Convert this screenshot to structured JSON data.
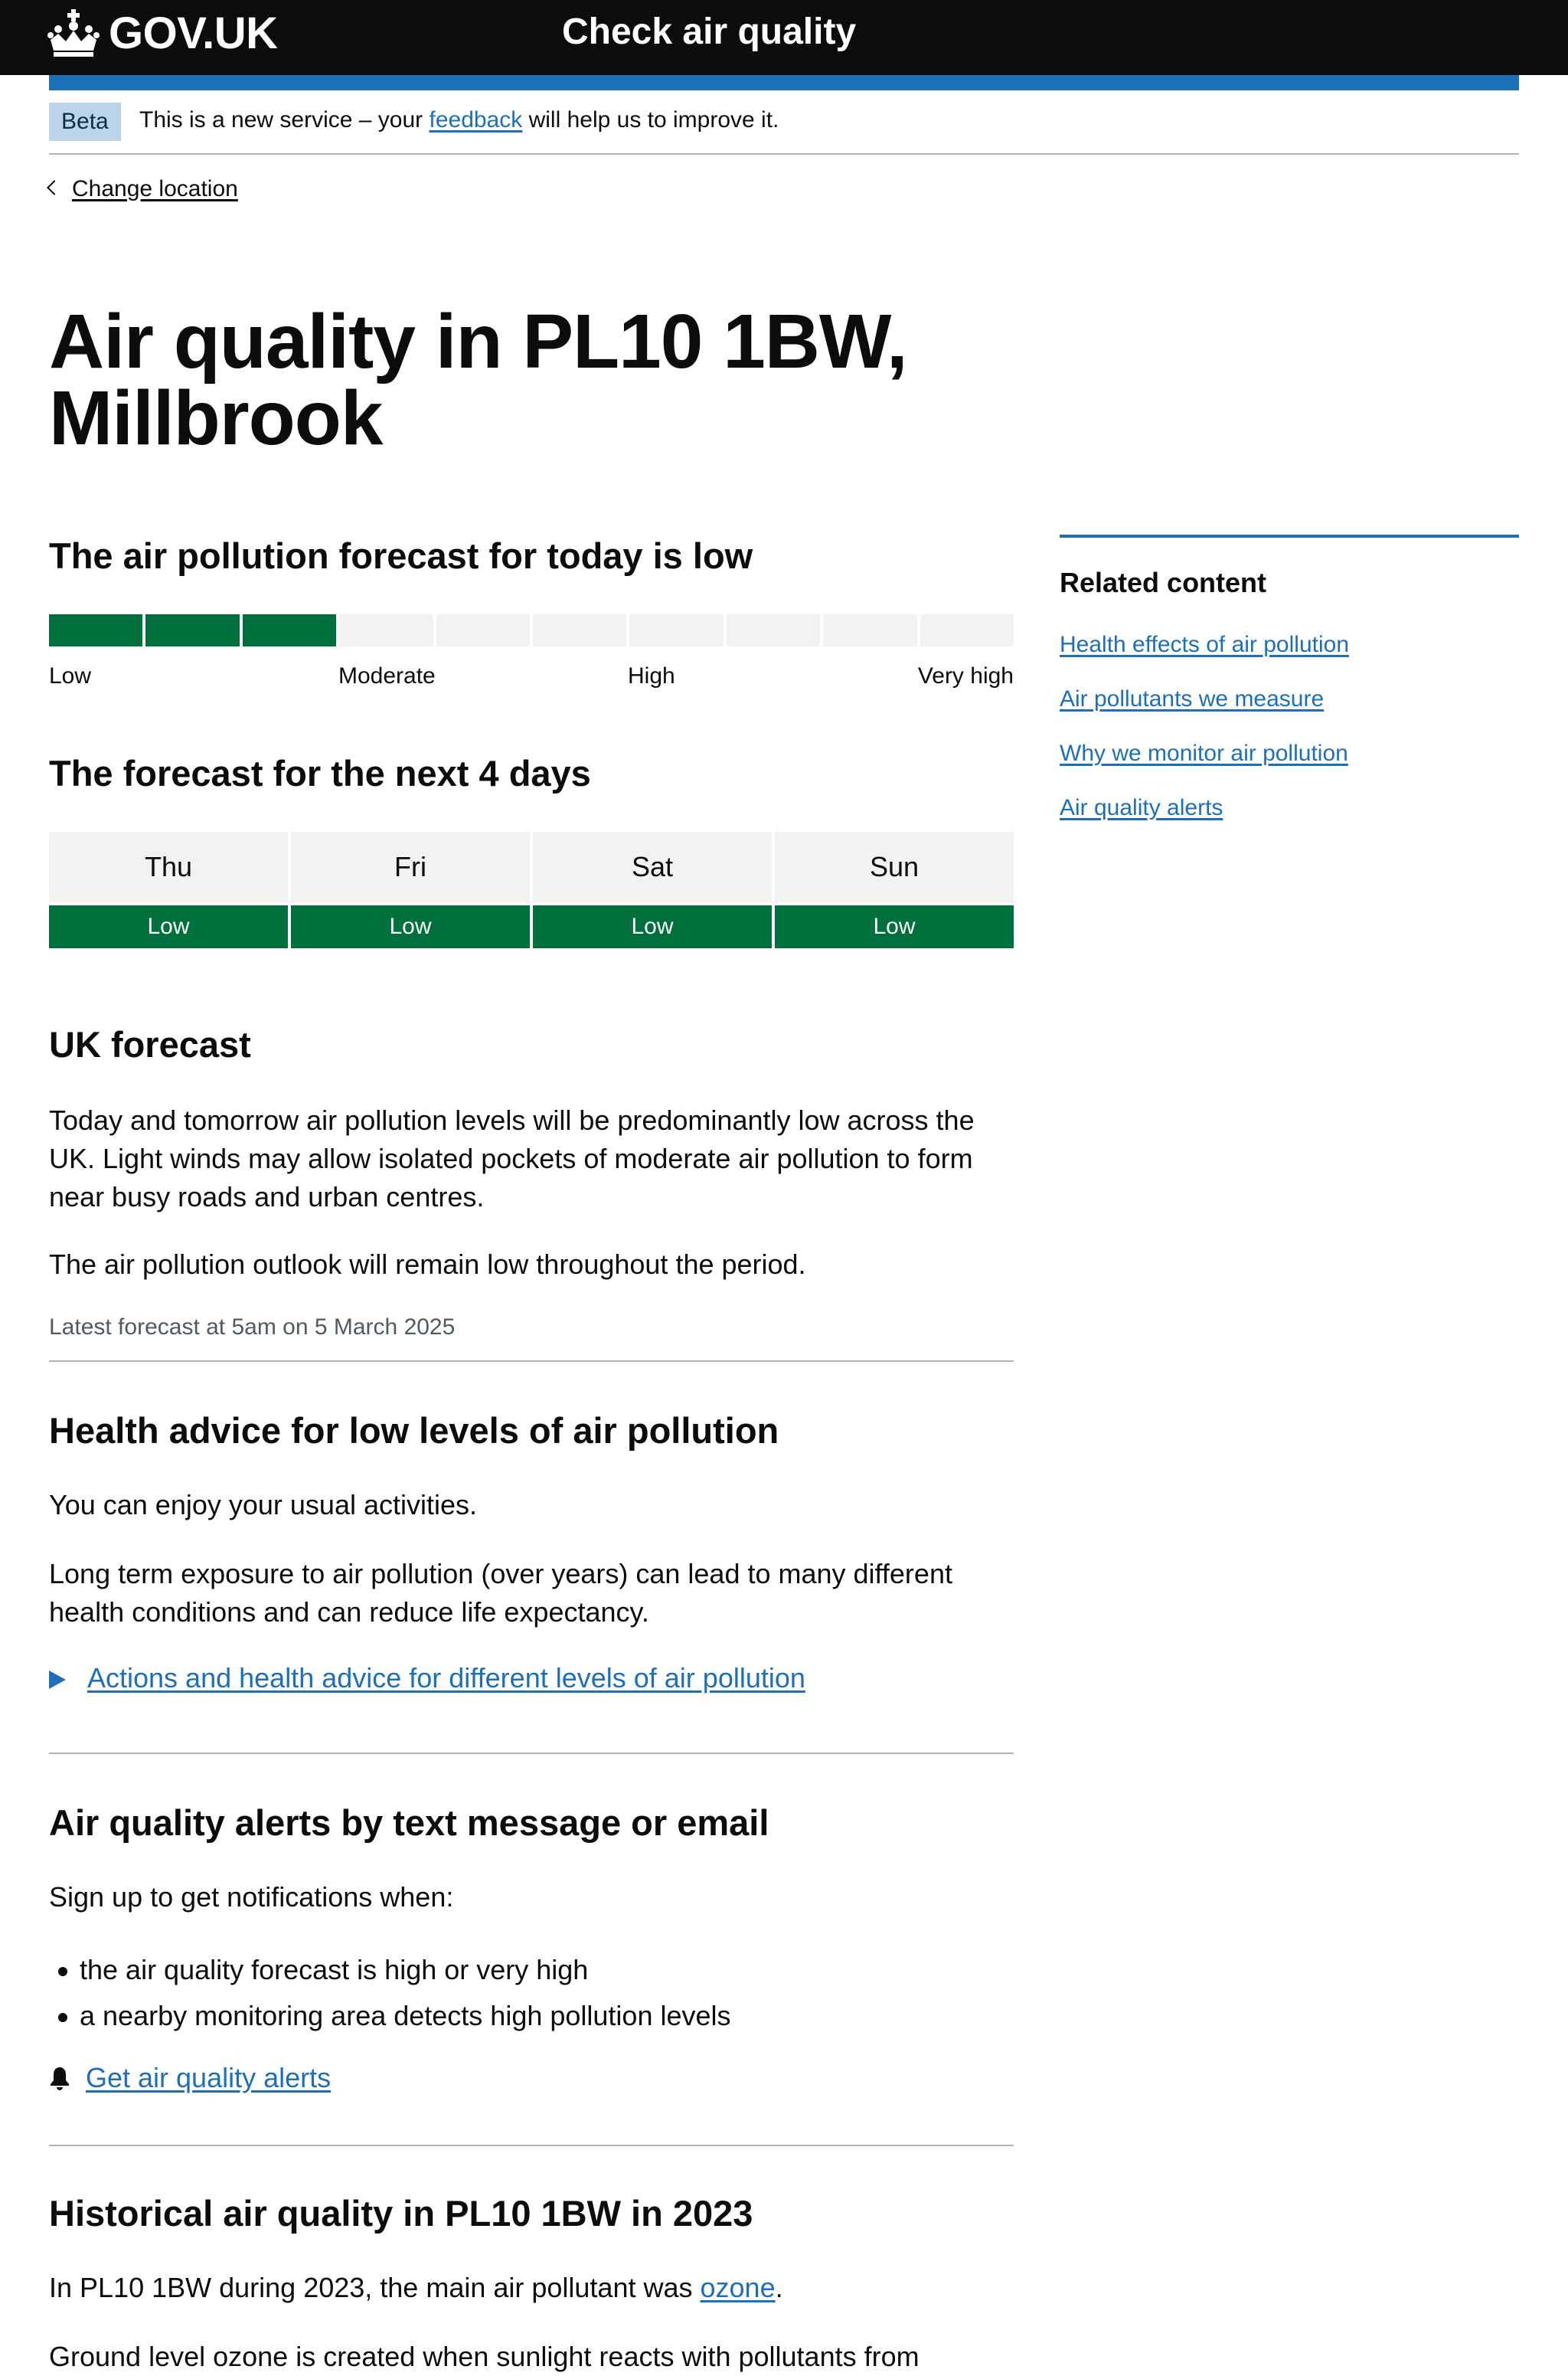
{
  "header": {
    "logo_text": "GOV.UK",
    "service_name": "Check air quality",
    "colors": {
      "header_bg": "#0b0c0c",
      "accent": "#1d70b8"
    }
  },
  "phase_banner": {
    "tag": "Beta",
    "text_before": "This is a new service – your",
    "link": "feedback",
    "text_after": "will help us to improve it."
  },
  "back_link": {
    "label": "Change location",
    "icon": "chevron-left-icon"
  },
  "page_title": "Air quality in PL10 1BW, Millbrook",
  "today": {
    "heading": "The air pollution forecast for today is low",
    "index_level": 3,
    "index_max": 10,
    "scale_labels": [
      "Low",
      "Moderate",
      "High",
      "Very high"
    ],
    "colors": {
      "filled": "#00703c",
      "empty": "#f3f2f1"
    }
  },
  "forecast": {
    "heading": "The forecast for the next 4 days",
    "days": [
      {
        "day": "Thu",
        "level": "Low"
      },
      {
        "day": "Fri",
        "level": "Low"
      },
      {
        "day": "Sat",
        "level": "Low"
      },
      {
        "day": "Sun",
        "level": "Low"
      }
    ]
  },
  "uk_forecast": {
    "heading": "UK forecast",
    "paragraphs": [
      "Today and tomorrow air pollution levels will be predominantly low across the UK. Light winds may allow isolated pockets of moderate air pollution to form near busy roads and urban centres.",
      "The air pollution outlook will remain low throughout the period."
    ],
    "meta": "Latest forecast at 5am on 5 March 2025"
  },
  "health": {
    "heading": "Health advice for low levels of air pollution",
    "paragraphs": [
      "You can enjoy your usual activities.",
      "Long term exposure to air pollution (over years) can lead to many different health conditions and can reduce life expectancy."
    ],
    "details_summary": "Actions and health advice for different levels of air pollution"
  },
  "alerts": {
    "heading": "Air quality alerts by text message or email",
    "intro": "Sign up to get notifications when:",
    "items": [
      "the air quality forecast is high or very high",
      "a nearby monitoring area detects high pollution levels"
    ],
    "link": "Get air quality alerts",
    "icon": "bell-icon"
  },
  "historical": {
    "heading": "Historical air quality in PL10 1BW in 2023",
    "text_before": "In PL10 1BW during 2023, the main air pollutant was",
    "link": "ozone",
    "text_after": ".",
    "partial_paragraph": "Ground level ozone is created when sunlight reacts with pollutants from"
  },
  "related": {
    "heading": "Related content",
    "links": [
      "Health effects of air pollution",
      "Air pollutants we measure",
      "Why we monitor air pollution",
      "Air quality alerts"
    ]
  }
}
